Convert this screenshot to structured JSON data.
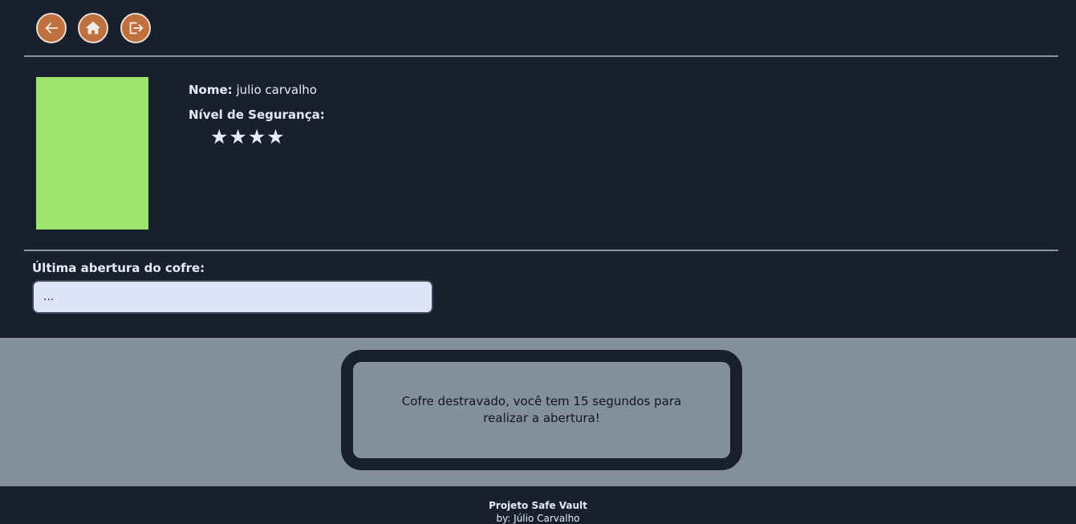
{
  "nav": {
    "back_icon": "arrow-left-icon",
    "home_icon": "home-icon",
    "logout_icon": "logout-icon",
    "accent_color": "#c0703f"
  },
  "profile": {
    "photo_color": "#9be36a",
    "name_label": "Nome:",
    "name_value": "julio carvalho",
    "security_label": "Nível de Segurança:",
    "security_stars": "★★★★",
    "security_level": 4
  },
  "last_open": {
    "label": "Última abertura do cofre:",
    "value": "..."
  },
  "notice": {
    "message": "Cofre destravado, você tem 15 segundos para realizar a abertura!"
  },
  "footer": {
    "title": "Projeto Safe Vault",
    "byline": "by: Júlio Carvalho"
  }
}
